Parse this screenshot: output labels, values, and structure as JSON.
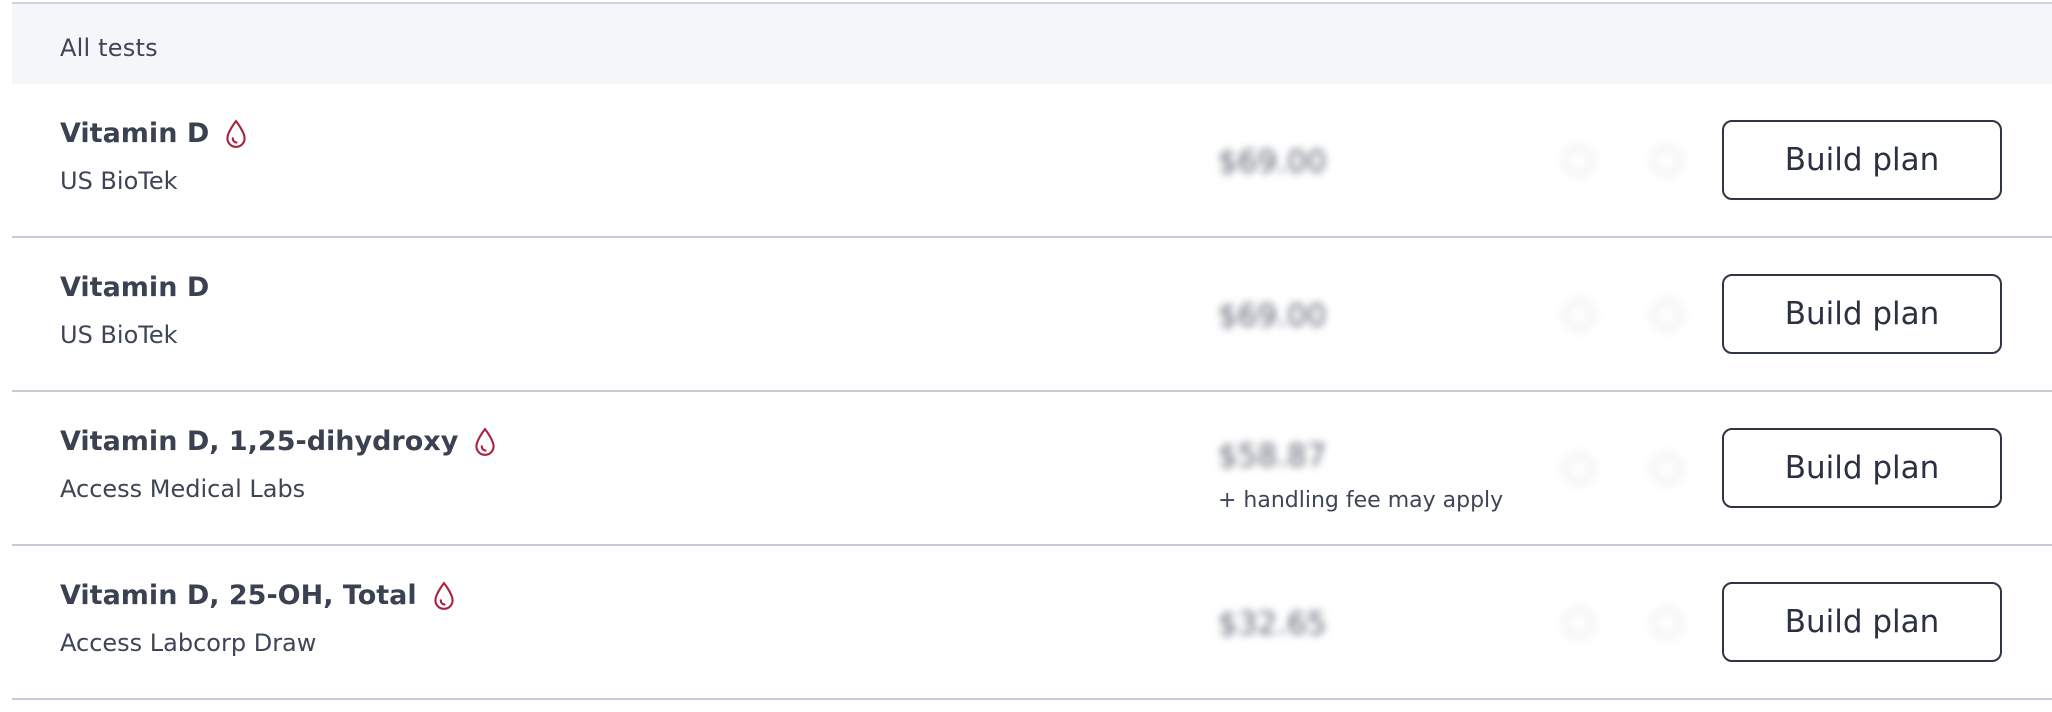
{
  "table": {
    "header": "All tests",
    "rows": [
      {
        "name": "Vitamin D",
        "lab": "US BioTek",
        "price": "$69.00",
        "fee_note": "",
        "drop_icon": true,
        "button_label": "Build plan"
      },
      {
        "name": "Vitamin D",
        "lab": "US BioTek",
        "price": "$69.00",
        "fee_note": "",
        "drop_icon": false,
        "button_label": "Build plan"
      },
      {
        "name": "Vitamin D, 1,25-dihydroxy",
        "lab": "Access Medical Labs",
        "price": "$58.87",
        "fee_note": "+ handling fee may apply",
        "drop_icon": true,
        "button_label": "Build plan"
      },
      {
        "name": "Vitamin D, 25-OH, Total",
        "lab": "Access Labcorp Draw",
        "price": "$32.65",
        "fee_note": "",
        "drop_icon": true,
        "button_label": "Build plan"
      }
    ]
  },
  "icons": {
    "drop": "blood-drop-icon"
  },
  "colors": {
    "drop_icon": "#a8243e",
    "text": "#3d4556",
    "header_bg": "#f5f6fa",
    "divider": "#c6ccd6",
    "button_border": "#2e3544"
  }
}
